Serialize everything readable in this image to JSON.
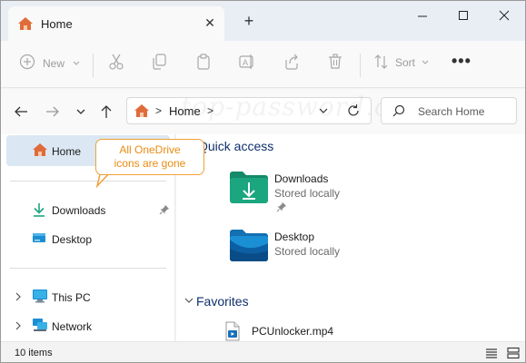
{
  "tab": {
    "title": "Home"
  },
  "toolbar": {
    "new_label": "New",
    "sort_label": "Sort",
    "more_label": "•••"
  },
  "address": {
    "crumb": "Home",
    "separator": ">",
    "search_placeholder": "Search Home",
    "watermark": "top-password.com"
  },
  "sidebar": {
    "home": "Home",
    "downloads": "Downloads",
    "desktop": "Desktop",
    "this_pc": "This PC",
    "network": "Network"
  },
  "callout": {
    "line1": "All OneDrive",
    "line2": "icons are gone",
    "color": "#f0a13a"
  },
  "quick_access": {
    "header": "Quick access",
    "items": [
      {
        "name": "Downloads",
        "status": "Stored locally",
        "icon": "downloads-folder-icon",
        "pinned": true
      },
      {
        "name": "Desktop",
        "status": "Stored locally",
        "icon": "desktop-folder-icon",
        "pinned": false
      }
    ]
  },
  "favorites": {
    "header": "Favorites",
    "items": [
      {
        "name": "PCUnlocker.mp4",
        "icon": "video-file-icon"
      }
    ]
  },
  "status": {
    "item_count": "10 items"
  },
  "colors": {
    "accent": "#0067c0",
    "selection": "#dbe7f3",
    "home_icon": "#d9663a",
    "folder_teal": "#1ba67f",
    "folder_blue": "#1b8fd4",
    "group_header": "#0f2f6b"
  }
}
